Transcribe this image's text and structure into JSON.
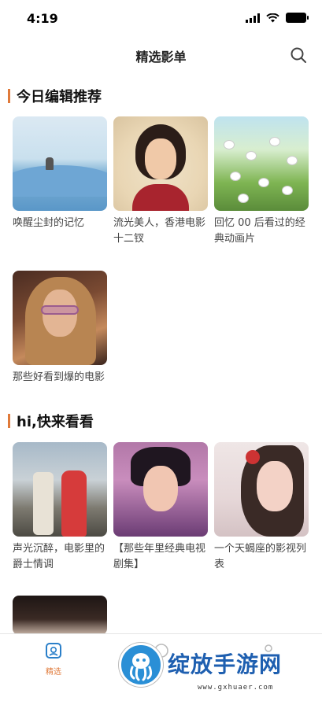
{
  "status_bar": {
    "time": "4:19"
  },
  "nav": {
    "title": "精选影单"
  },
  "sections": [
    {
      "title": "今日编辑推荐",
      "items": [
        {
          "label": "唤醒尘封的记忆"
        },
        {
          "label": "流光美人，香港电影十二钗"
        },
        {
          "label": "回忆 00 后看过的经典动画片"
        },
        {
          "label": "那些好看到爆的电影"
        }
      ]
    },
    {
      "title": "hi,快来看看",
      "items": [
        {
          "label": "声光沉醉，电影里的爵士情调"
        },
        {
          "label": "【那些年里经典电视剧集】"
        },
        {
          "label": "一个天蝎座的影视列表"
        }
      ]
    }
  ],
  "tab_bar": {
    "tabs": [
      {
        "label": "精选"
      }
    ]
  },
  "watermark": {
    "text": "绽放手游网",
    "url": "www.gxhuaer.com"
  },
  "colors": {
    "accent": "#e07a3a",
    "watermark_blue": "#1e5fb0"
  }
}
